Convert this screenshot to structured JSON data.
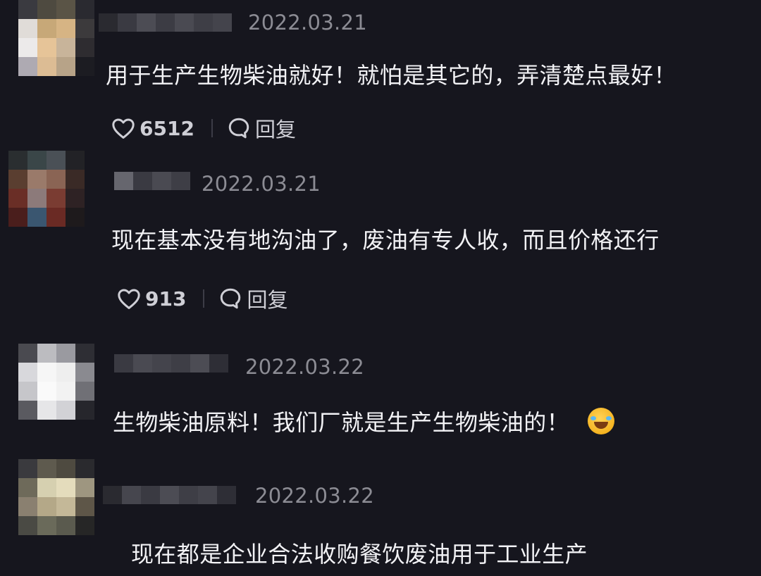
{
  "comments": [
    {
      "date": "2022.03.21",
      "text": "用于生产生物柴油就好！就怕是其它的，弄清楚点最好！",
      "likes": "6512",
      "reply_label": "回复"
    },
    {
      "date": "2022.03.21",
      "text": "现在基本没有地沟油了，废油有专人收，而且价格还行",
      "likes": "913",
      "reply_label": "回复"
    },
    {
      "date": "2022.03.22",
      "text": "生物柴油原料！我们厂就是生产生物柴油的！",
      "emoji": "rolling-on-floor-laughing-emoji"
    },
    {
      "date": "2022.03.22",
      "text": "现在都是企业合法收购餐饮废油用于工业生产"
    }
  ],
  "icons": {
    "like": "heart-icon",
    "reply": "comment-bubble-icon"
  },
  "colors": {
    "background": "#16161e",
    "text": "#f2f2f5",
    "date": "#8c8c94",
    "action": "#cfcfd6"
  }
}
